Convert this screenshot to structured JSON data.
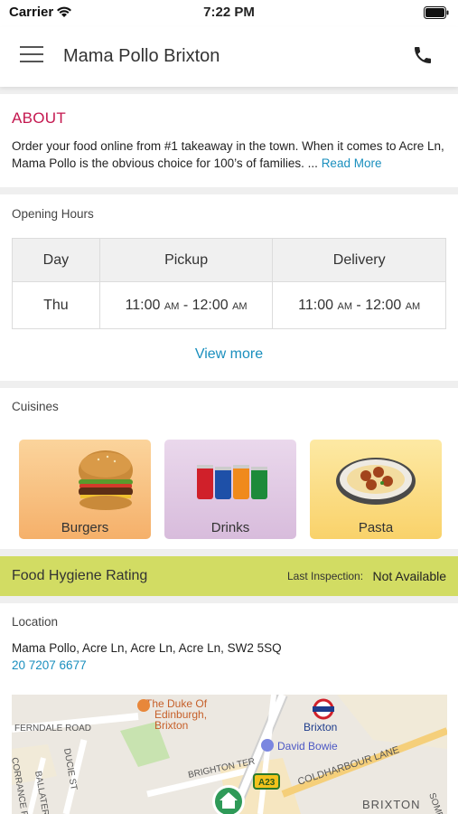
{
  "status_bar": {
    "carrier": "Carrier",
    "time": "7:22 PM"
  },
  "header": {
    "title": "Mama Pollo Brixton",
    "menu_icon": "hamburger-menu-icon",
    "phone_icon": "phone-icon"
  },
  "about": {
    "title": "ABOUT",
    "text": "Order your food online from #1 takeaway in the town. When it comes to Acre Ln, Mama Pollo is the obvious choice for 100’s of families. ...",
    "read_more": "Read More"
  },
  "opening_hours": {
    "label": "Opening Hours",
    "columns": [
      "Day",
      "Pickup",
      "Delivery"
    ],
    "rows": [
      {
        "day": "Thu",
        "pickup_start": "11:00",
        "pickup_end": "12:00",
        "delivery_start": "11:00",
        "delivery_end": "12:00",
        "period": "AM"
      }
    ],
    "view_more": "View more"
  },
  "cuisines": {
    "label": "Cuisines",
    "items": [
      {
        "name": "Burgers",
        "icon": "burger-icon"
      },
      {
        "name": "Drinks",
        "icon": "drinks-icon"
      },
      {
        "name": "Pasta",
        "icon": "pasta-icon"
      }
    ]
  },
  "hygiene": {
    "title": "Food Hygiene Rating",
    "inspection_label": "Last Inspection:",
    "inspection_value": "Not Available"
  },
  "location": {
    "label": "Location",
    "address": "Mama Pollo, Acre Ln, Acre Ln, Acre Ln, SW2 5SQ",
    "phone": "20 7207 6677",
    "map_labels": {
      "pub": "The Duke Of Edinburgh, Brixton",
      "ferndale": "FERNDALE ROAD",
      "ducie": "DUCIE ST",
      "ballater": "BALLATER ROAD",
      "corrance": "CORRANCE ROAD",
      "brighton": "BRIGHTON TER",
      "station": "Brixton",
      "bowie": "David Bowie",
      "a23": "A23",
      "coldharbour": "COLDHARBOUR LANE",
      "brixton_area": "BRIXTON",
      "some": "SOME"
    }
  }
}
